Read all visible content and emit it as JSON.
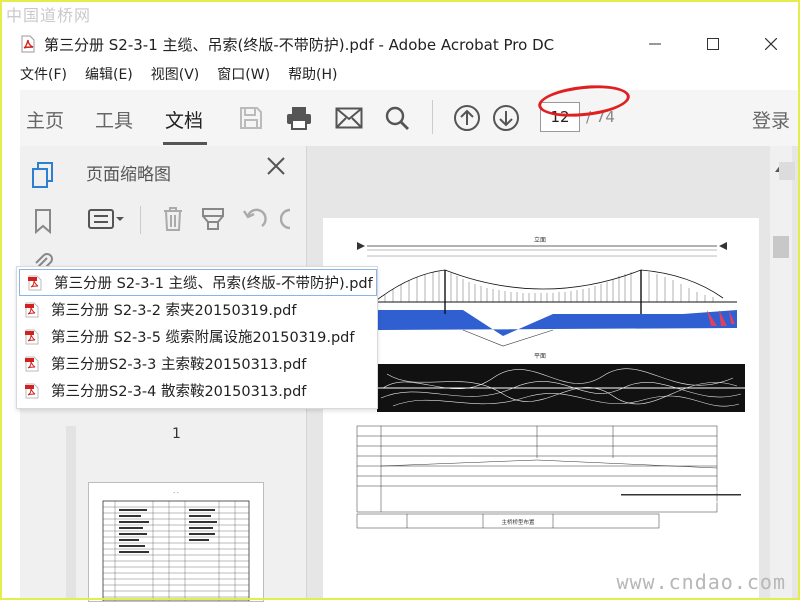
{
  "watermarks": {
    "top": "中国道桥网",
    "bottom": "www.cndao.com"
  },
  "window": {
    "title": "第三分册 S2-3-1 主缆、吊索(终版-不带防护).pdf - Adobe Acrobat Pro DC",
    "controls": {
      "minimize": "—",
      "maximize": "☐",
      "close": "✕"
    }
  },
  "menu": [
    "文件(F)",
    "编辑(E)",
    "视图(V)",
    "窗口(W)",
    "帮助(H)"
  ],
  "toolbar": {
    "tabs": [
      "主页",
      "工具",
      "文档"
    ],
    "active_tab": "文档",
    "page_current": "12",
    "page_total": "/ 74",
    "login": "登录",
    "icons": [
      "save-icon",
      "print-icon",
      "mail-icon",
      "search-icon",
      "page-up-icon",
      "page-down-icon"
    ]
  },
  "thumbnails_panel": {
    "title": "页面缩略图",
    "page_label": "1",
    "icons": [
      "options-menu-icon",
      "delete-icon",
      "extract-icon",
      "undo-icon"
    ]
  },
  "rail": {
    "icons": [
      "pages-icon",
      "bookmark-icon",
      "attachment-icon"
    ]
  },
  "open_files": [
    "第三分册 S2-3-1 主缆、吊索(终版-不带防护).pdf",
    "第三分册 S2-3-2 索夹20150319.pdf",
    "第三分册 S2-3-5 缆索附属设施20150319.pdf",
    "第三分册S2-3-3 主索鞍20150313.pdf",
    "第三分册S2-3-4 散索鞍20150313.pdf"
  ],
  "open_files_selected_index": 0,
  "document": {
    "drawing_title_elevation": "立面",
    "drawing_title_plan": "平面",
    "sheet_name": "主桥桥型布置",
    "accent": "#2f5fd0"
  },
  "colors": {
    "oval": "#e02020",
    "frame": "#e3ee4a",
    "pdf_red": "#d0211c"
  }
}
